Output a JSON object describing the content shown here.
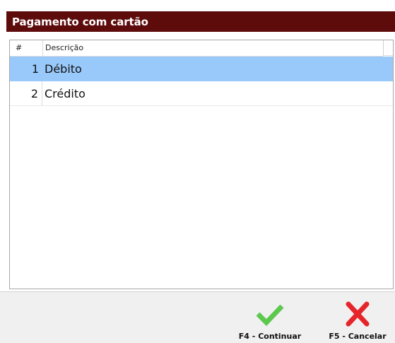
{
  "dialog": {
    "title": "Pagamento com cartão"
  },
  "grid": {
    "columns": [
      "#",
      "Descrição"
    ],
    "rows": [
      {
        "num": "1",
        "desc": "Débito",
        "selected": true
      },
      {
        "num": "2",
        "desc": "Crédito",
        "selected": false
      }
    ]
  },
  "footer": {
    "continue_label": "F4 - Continuar",
    "continue_icon": "check-icon",
    "cancel_label": "F5 - Cancelar",
    "cancel_icon": "x-icon"
  },
  "colors": {
    "title_bar": "#5e0b0b",
    "selection": "#99c9fb",
    "check": "#5cc84e",
    "cancel": "#e5252a"
  }
}
